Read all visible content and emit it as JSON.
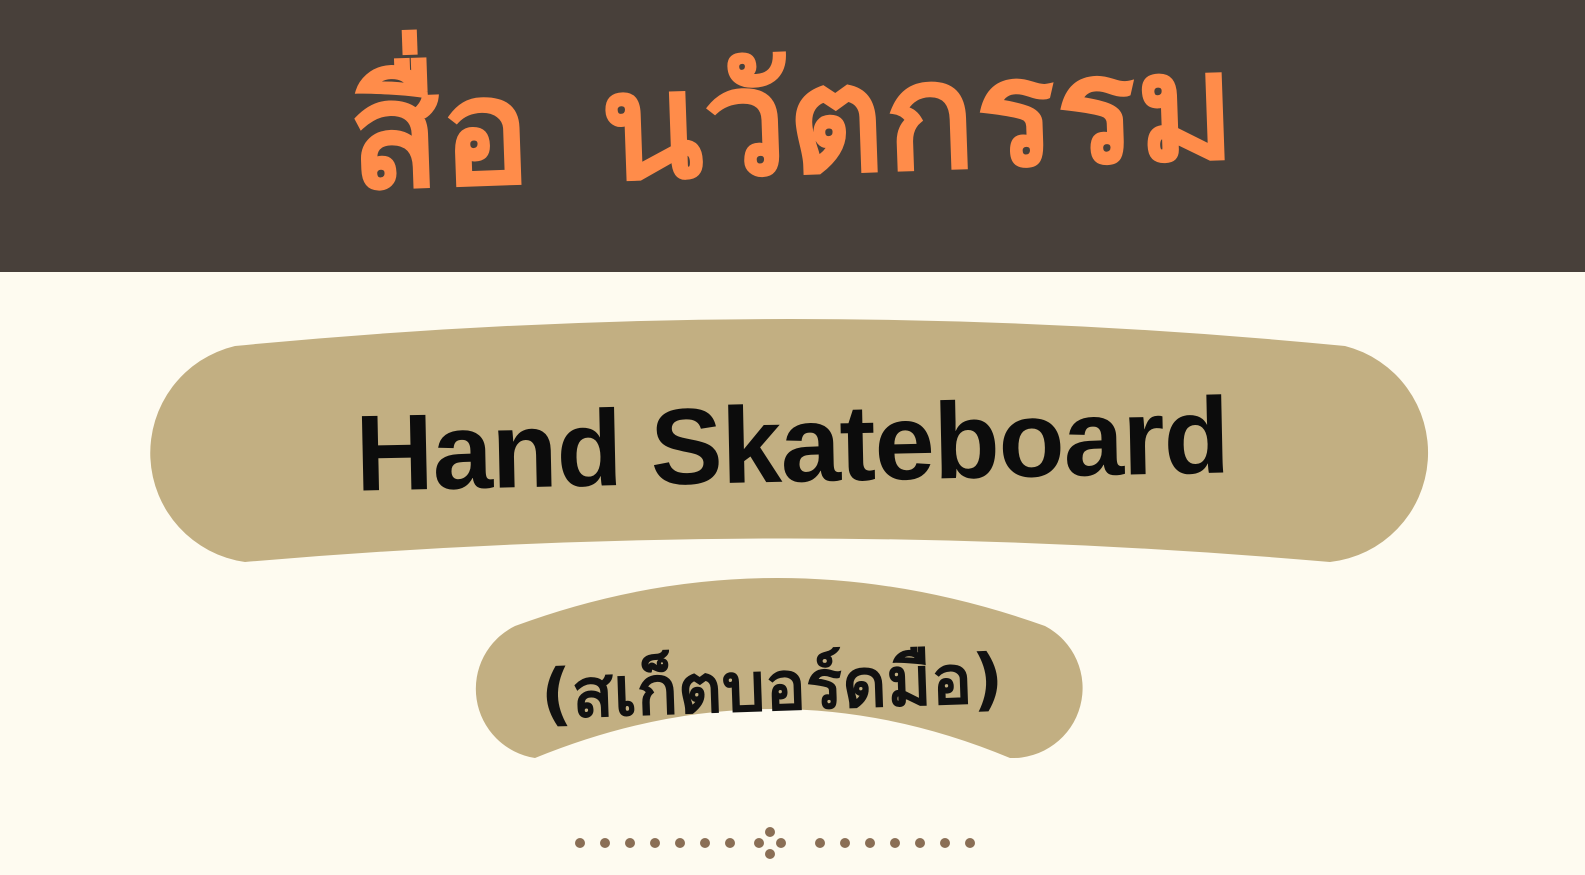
{
  "header": {
    "title_word1": "สื่อ",
    "title_word2": "นวัตกรรม"
  },
  "banner": {
    "title": "Hand Skateboard",
    "subtitle": "(สเก็ตบอร์ดมือ)"
  },
  "divider": {
    "ornament": "decorative-dots-divider"
  },
  "colors": {
    "header_bg": "#48403A",
    "title_orange": "#FF8C4A",
    "page_bg": "#FEFBF0",
    "banner_tan": "#C2AF82",
    "text_dark": "#0C0C0C",
    "dot_brown": "#8A6E55"
  }
}
